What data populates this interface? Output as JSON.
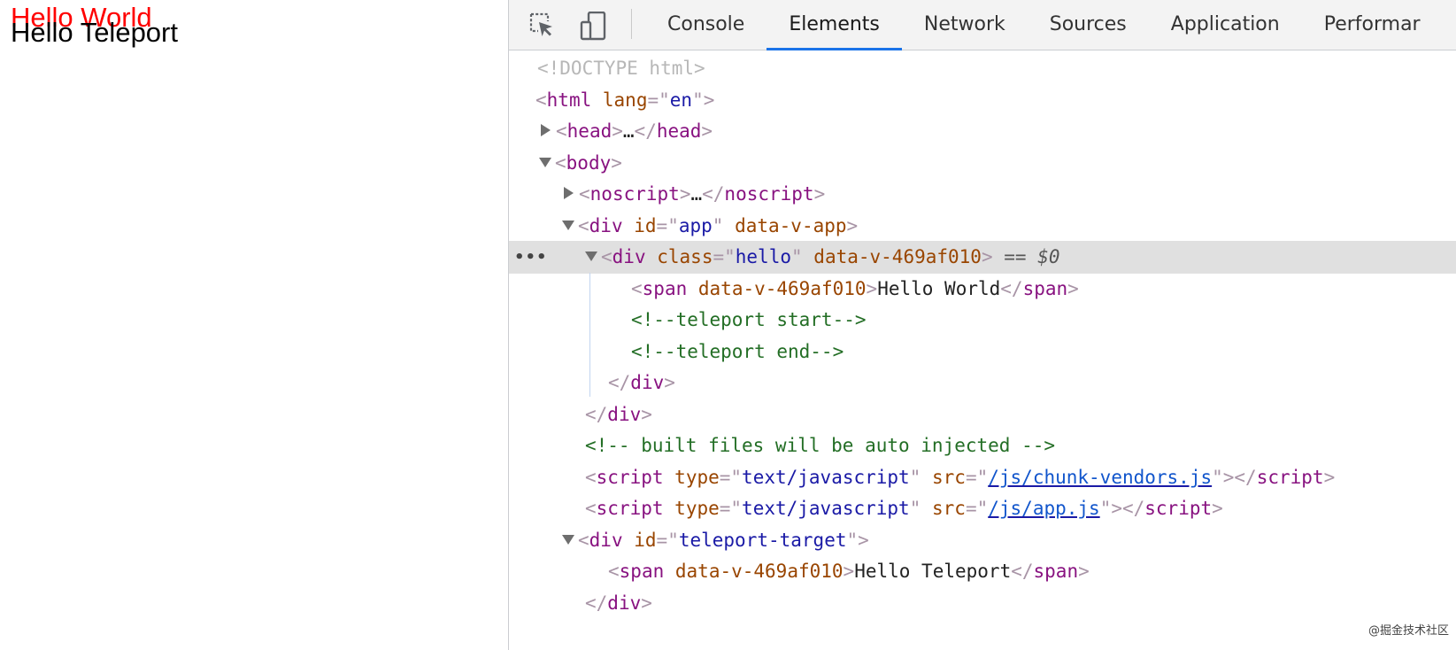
{
  "viewport": {
    "hello_world": "Hello World",
    "hello_teleport": "Hello Teleport"
  },
  "devtools": {
    "tabs": [
      "Console",
      "Elements",
      "Network",
      "Sources",
      "Application",
      "Performar"
    ],
    "active_tab": "Elements",
    "tree": {
      "doctype": "<!DOCTYPE html>",
      "html_tag": "html",
      "html_attr": "lang",
      "html_attr_val": "en",
      "head_tag": "head",
      "body_tag": "body",
      "noscript_tag": "noscript",
      "ellipsis": "…",
      "div_tag": "div",
      "app_id_attr": "id",
      "app_id_val": "app",
      "app_data_attr": "data-v-app",
      "hello_class_attr": "class",
      "hello_class_val": "hello",
      "scope_attr": "data-v-469af010",
      "selected_marker": "== $0",
      "span_tag": "span",
      "span_text": "Hello World",
      "teleport_start_comment": "<!--teleport start-->",
      "teleport_end_comment": "<!--teleport end-->",
      "built_comment": "<!-- built files will be auto injected -->",
      "script_tag": "script",
      "type_attr": "type",
      "type_val": "text/javascript",
      "src_attr": "src",
      "vendors_src": "/js/chunk-vendors.js",
      "app_src": "/js/app.js",
      "target_id_val": "teleport-target",
      "teleport_span_text": "Hello Teleport"
    },
    "row_dots": "•••"
  },
  "watermark": "@掘金技术社区"
}
